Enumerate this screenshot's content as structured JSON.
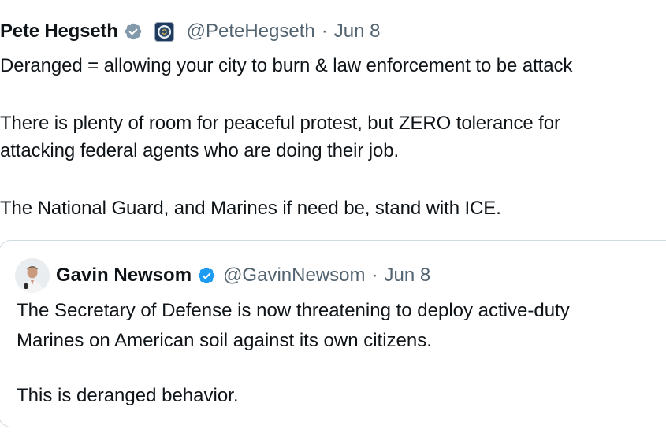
{
  "tweet": {
    "author_name": "Pete Hegseth",
    "handle": "@PeteHegseth",
    "separator": "·",
    "date": "Jun 8",
    "lines": [
      "Deranged = allowing your city to burn & law enforcement to be attack",
      "There is plenty of room for peaceful protest, but ZERO tolerance for",
      "attacking federal agents who are doing their job.",
      "The National Guard, and Marines if need be, stand with ICE."
    ]
  },
  "quote": {
    "author_name": "Gavin Newsom",
    "handle": "@GavinNewsom",
    "separator": "·",
    "date": "Jun 8",
    "lines": [
      "The Secretary of Defense is now threatening to deploy active-duty",
      "Marines on American soil against its own citizens.",
      "This is deranged behavior."
    ]
  },
  "colors": {
    "verified_gray": "#829aab",
    "verified_blue": "#1d9bf0",
    "secondary_text": "#536471",
    "border": "#cfd9de"
  },
  "icons": {
    "author_badge": "verified-gray-badge-icon",
    "org_badge": "dod-seal-icon",
    "quote_badge": "verified-blue-badge-icon"
  }
}
